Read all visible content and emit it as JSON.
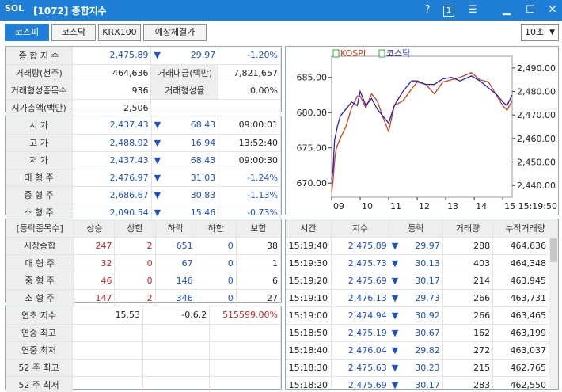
{
  "window": {
    "logo": "SOL",
    "title": "[1072] 종합지수",
    "help": "?",
    "info_icon": "1"
  },
  "tabs": [
    {
      "label": "코스피"
    },
    {
      "label": "코스닥"
    },
    {
      "label": "KRX100"
    },
    {
      "label": "예상체결가"
    }
  ],
  "interval": "10초",
  "summary": {
    "r1": {
      "label": "종 합 지 수",
      "value": "2,475.89",
      "arrow": "▼",
      "change": "29.97",
      "rate": "-1.20%"
    },
    "r2": {
      "label": "거래량(천주)",
      "value": "464,636",
      "label2": "거래대금(백만)",
      "value2": "7,821,657"
    },
    "r3": {
      "label": "거래형성종목수",
      "value": "936",
      "label2": "거래형성율",
      "value2": "0.00%"
    },
    "r4": {
      "label": "시가총액(백만)",
      "value": "2,506"
    }
  },
  "prices": [
    {
      "label": "시  가",
      "value": "2,437.43",
      "arrow": "▼",
      "change": "68.43",
      "extra": "09:00:01",
      "extra_color": "black"
    },
    {
      "label": "고  가",
      "value": "2,488.92",
      "arrow": "▼",
      "change": "16.94",
      "extra": "13:52:40",
      "extra_color": "black"
    },
    {
      "label": "저  가",
      "value": "2,437.43",
      "arrow": "▼",
      "change": "68.43",
      "extra": "09:00:30",
      "extra_color": "black"
    },
    {
      "label": "대 형 주",
      "value": "2,476.97",
      "arrow": "▼",
      "change": "31.03",
      "extra": "-1.24%",
      "extra_color": "blue"
    },
    {
      "label": "중 형 주",
      "value": "2,686.67",
      "arrow": "▼",
      "change": "30.83",
      "extra": "-1.13%",
      "extra_color": "blue"
    },
    {
      "label": "소 형 주",
      "value": "2,090.54",
      "arrow": "▼",
      "change": "15.46",
      "extra": "-0.73%",
      "extra_color": "blue"
    }
  ],
  "breadth": {
    "headers": [
      "[등락종목수]",
      "상승",
      "상한",
      "하락",
      "하한",
      "보합"
    ],
    "rows": [
      {
        "label": "시장종합",
        "up": "247",
        "uplim": "2",
        "down": "651",
        "downlim": "0",
        "flat": "38"
      },
      {
        "label": "대 형 주",
        "up": "32",
        "uplim": "0",
        "down": "67",
        "downlim": "0",
        "flat": "1"
      },
      {
        "label": "중 형 주",
        "up": "46",
        "uplim": "0",
        "down": "146",
        "downlim": "0",
        "flat": "6"
      },
      {
        "label": "소 형 주",
        "up": "147",
        "uplim": "2",
        "down": "346",
        "downlim": "0",
        "flat": "27"
      }
    ]
  },
  "yearly": {
    "r1": {
      "label": "연초  지수",
      "value": "15.53",
      "change": "-0.6.2",
      "rate": "515599.00%"
    },
    "r2": {
      "label": "연중  최고"
    },
    "r3": {
      "label": "연중  최저"
    },
    "r4": {
      "label": "52 주 최고"
    },
    "r5": {
      "label": "52 주 최저"
    }
  },
  "ticks": {
    "headers": [
      "시간",
      "지수",
      "등락",
      "거래량",
      "누적거래량"
    ],
    "rows": [
      {
        "time": "15:19:40",
        "index": "2,475.89",
        "arrow": "▼",
        "change": "29.97",
        "vol": "288",
        "cum": "464,636"
      },
      {
        "time": "15:19:30",
        "index": "2,475.73",
        "arrow": "▼",
        "change": "30.13",
        "vol": "403",
        "cum": "464,348"
      },
      {
        "time": "15:19:20",
        "index": "2,475.69",
        "arrow": "▼",
        "change": "30.17",
        "vol": "214",
        "cum": "463,945"
      },
      {
        "time": "15:19:10",
        "index": "2,476.13",
        "arrow": "▼",
        "change": "29.73",
        "vol": "266",
        "cum": "463,731"
      },
      {
        "time": "15:19:00",
        "index": "2,474.94",
        "arrow": "▼",
        "change": "30.92",
        "vol": "266",
        "cum": "463,465"
      },
      {
        "time": "15:18:50",
        "index": "2,475.19",
        "arrow": "▼",
        "change": "30.67",
        "vol": "162",
        "cum": "463,199"
      },
      {
        "time": "15:18:40",
        "index": "2,476.04",
        "arrow": "▼",
        "change": "29.82",
        "vol": "272",
        "cum": "463,037"
      },
      {
        "time": "15:18:30",
        "index": "2,475.63",
        "arrow": "▼",
        "change": "30.23",
        "vol": "215",
        "cum": "462,765"
      },
      {
        "time": "15:18:20",
        "index": "2,475.69",
        "arrow": "▼",
        "change": "30.17",
        "vol": "283",
        "cum": "462,550"
      }
    ]
  },
  "chart_data": {
    "type": "line",
    "legend": [
      "KOSPI",
      "코스닥"
    ],
    "x_ticks": [
      "09",
      "10",
      "11",
      "12",
      "13",
      "14",
      "15"
    ],
    "x_end_label": "15:19:50",
    "left_ticks": [
      "685.00",
      "680.00",
      "675.00",
      "670.00"
    ],
    "right_ticks": [
      "2,490.00",
      "2,480.00",
      "2,470.00",
      "2,460.00",
      "2,450.00",
      "2,440.00"
    ],
    "left_range": [
      668,
      688
    ],
    "right_range": [
      2435,
      2495
    ],
    "series": [
      {
        "name": "KOSPI",
        "axis": "right",
        "color": "#d4401a",
        "x": [
          9.0,
          9.05,
          9.1,
          9.15,
          9.2,
          9.3,
          9.5,
          9.7,
          9.9,
          10.0,
          10.2,
          10.4,
          10.6,
          10.8,
          11.0,
          11.2,
          11.5,
          11.8,
          12.0,
          12.3,
          12.6,
          12.9,
          13.2,
          13.5,
          13.9,
          14.2,
          14.5,
          14.8,
          15.0,
          15.15,
          15.33
        ],
        "y": [
          2437,
          2442,
          2450,
          2455,
          2457,
          2460,
          2465,
          2473,
          2478,
          2478,
          2473,
          2479,
          2476,
          2469,
          2463,
          2474,
          2476,
          2481,
          2484,
          2483,
          2479,
          2484,
          2485,
          2486,
          2488,
          2485,
          2484,
          2478,
          2474,
          2472,
          2476
        ]
      },
      {
        "name": "코스닥",
        "axis": "left",
        "color": "#2020c0",
        "x": [
          9.0,
          9.05,
          9.1,
          9.2,
          9.3,
          9.5,
          9.7,
          9.9,
          10.0,
          10.2,
          10.4,
          10.6,
          10.8,
          11.0,
          11.2,
          11.5,
          11.8,
          12.0,
          12.3,
          12.6,
          12.9,
          13.2,
          13.5,
          13.9,
          14.2,
          14.5,
          14.8,
          15.0,
          15.15,
          15.33
        ],
        "y": [
          670.5,
          672,
          676,
          678,
          679.5,
          680.5,
          681.5,
          681,
          683,
          681,
          682,
          680.5,
          679.5,
          678.5,
          681,
          683,
          684.5,
          684.5,
          684,
          684,
          684.8,
          685,
          684.5,
          685.2,
          684.5,
          683.5,
          682.5,
          681.5,
          681,
          682.5
        ]
      }
    ]
  }
}
